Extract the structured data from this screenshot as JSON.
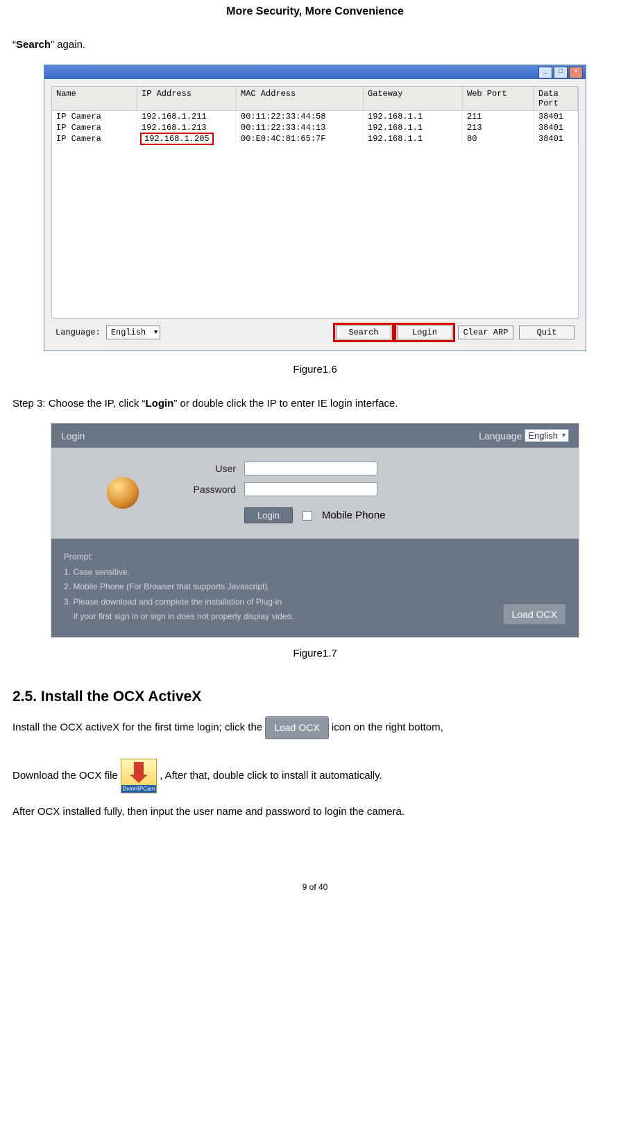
{
  "header": {
    "title": "More Security, More Convenience"
  },
  "intro": {
    "prefix": "“",
    "bold": "Search",
    "suffix": "” again."
  },
  "fig16": {
    "columns": [
      "Name",
      "IP Address",
      "MAC Address",
      "Gateway",
      "Web Port",
      "Data Port"
    ],
    "rows": [
      {
        "name": "IP Camera",
        "ip": "192.168.1.211",
        "mac": "00:11:22:33:44:58",
        "gw": "192.168.1.1",
        "web": "211",
        "data": "38401",
        "hl": false
      },
      {
        "name": "IP Camera",
        "ip": "192.168.1.213",
        "mac": "00:11:22:33:44:13",
        "gw": "192.168.1.1",
        "web": "213",
        "data": "38401",
        "hl": false
      },
      {
        "name": "IP Camera",
        "ip": "192.168.1.205",
        "mac": "00:E0:4C:81:65:7F",
        "gw": "192.168.1.1",
        "web": "80",
        "data": "38401",
        "hl": true
      }
    ],
    "language_label": "Language:",
    "language_value": "English",
    "btn_search": "Search",
    "btn_login": "Login",
    "btn_clear": "Clear ARP",
    "btn_quit": "Quit"
  },
  "caption16": "Figure1.6",
  "step3": {
    "pre": "Step 3: Choose the IP, click “",
    "bold": "Login",
    "post": "” or double click the IP to enter IE login interface."
  },
  "fig17": {
    "login_label": "Login",
    "language_label": "Language",
    "language_value": "English",
    "user_label": "User",
    "password_label": "Password",
    "login_btn": "Login",
    "mobile_label": "Mobile Phone",
    "prompt_title": "Prompt:",
    "p1": "1. Case sensitive.",
    "p2": "2. Mobile Phone (For Browser that supports Javascript).",
    "p3": "3. Please download and complete the installation of Plug-in",
    "p4": "if your first sign in or sign in does not properly display video.",
    "load_ocx": "Load OCX"
  },
  "caption17": "Figure1.7",
  "section25": {
    "heading": "2.5. Install the OCX ActiveX",
    "l1a": "Install the OCX activeX for the first time login; click the ",
    "inline_load": "Load OCX",
    "l1b": " icon on the right bottom,",
    "l2a": "Download the OCX file ",
    "dl_label": "DvmHIPCam",
    "l2b": ", After that, double click to install it automatically.",
    "l3": "After OCX installed fully, then input the user name and password to login the camera."
  },
  "footer": "9 of 40"
}
